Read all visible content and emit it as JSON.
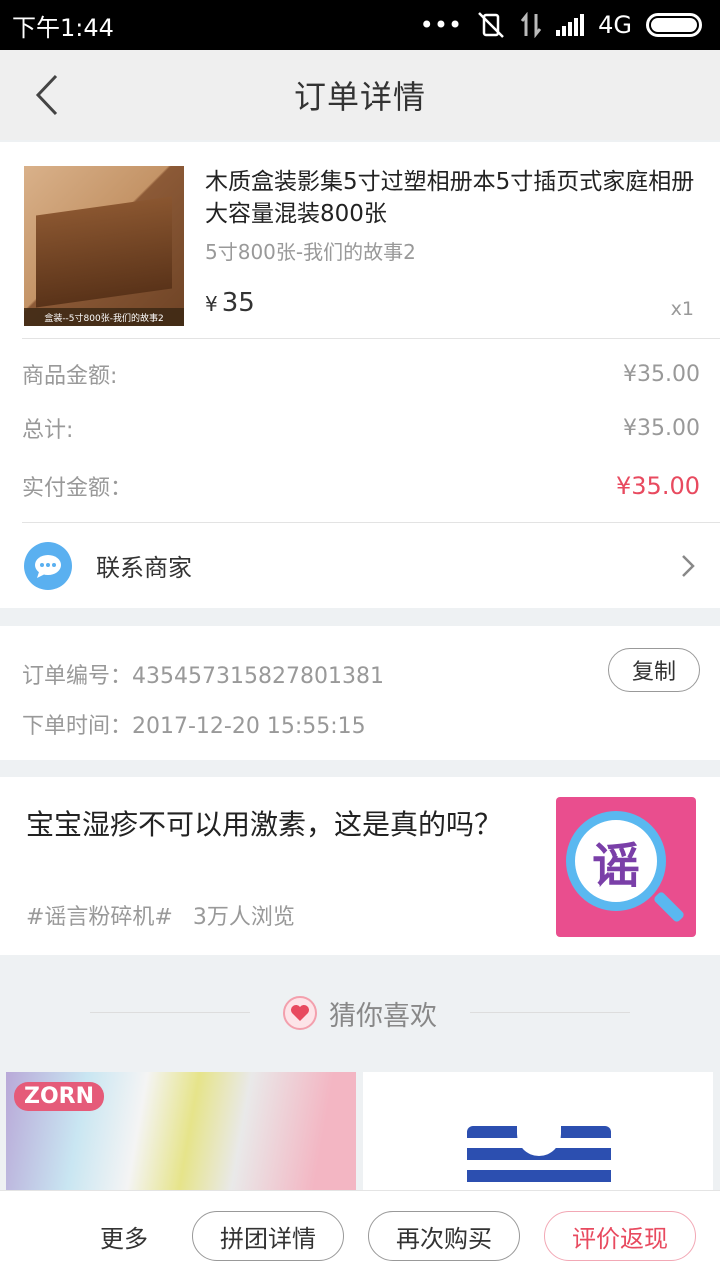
{
  "status_bar": {
    "time": "下午1:44",
    "dots": "•••",
    "network": "4G"
  },
  "header": {
    "title": "订单详情"
  },
  "product": {
    "title": "木质盒装影集5寸过塑相册本5寸插页式家庭相册大容量混装800张",
    "spec": "5寸800张-我们的故事2",
    "currency": "¥",
    "price": "35",
    "quantity": "x1",
    "image_caption": "盒装--5寸800张-我们的故事2"
  },
  "summary": {
    "goods_amount_label": "商品金额:",
    "goods_amount_value": "¥35.00",
    "total_label": "总计:",
    "total_value": "¥35.00",
    "paid_label": "实付金额：",
    "paid_value": "¥35.00"
  },
  "contact": {
    "label": "联系商家"
  },
  "order": {
    "number_text": "订单编号：435457315827801381",
    "time_text": "下单时间：2017-12-20 15:55:15",
    "copy_label": "复制"
  },
  "news": {
    "title": "宝宝湿疹不可以用激素，这是真的吗？",
    "tag": "#谣言粉碎机#",
    "views": "3万人浏览",
    "image_glyph": "谣"
  },
  "guess": {
    "label": "猜你喜欢"
  },
  "recommend": {
    "brand": "ZORN"
  },
  "bottom_bar": {
    "more": "更多",
    "group_detail": "拼团详情",
    "buy_again": "再次购买",
    "review": "评价返现"
  },
  "colors": {
    "accent_red": "#e84a5f",
    "contact_blue": "#5ab0f0"
  }
}
